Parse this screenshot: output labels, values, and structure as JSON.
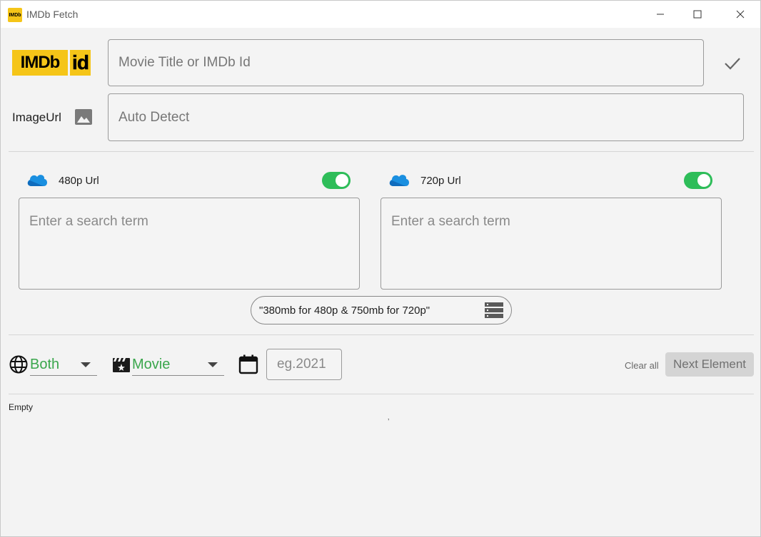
{
  "window": {
    "title": "IMDb Fetch",
    "app_icon_text": "IMDb"
  },
  "header": {
    "logo_imdb": "IMDb",
    "logo_id": "id",
    "title_input_placeholder": "Movie Title or IMDb Id",
    "image_url_label": "ImageUrl",
    "image_url_placeholder": "Auto Detect"
  },
  "urls": [
    {
      "label": "480p Url",
      "enabled": true,
      "placeholder": "Enter a search term"
    },
    {
      "label": "720p Url",
      "enabled": true,
      "placeholder": "Enter a search term"
    }
  ],
  "size_hint": "\"380mb for 480p & 750mb for 720p\"",
  "filters": {
    "language": "Both",
    "type": "Movie",
    "year_placeholder": "eg.2021",
    "clear_label": "Clear all",
    "next_label": "Next Element"
  },
  "status": {
    "empty_text": "Empty",
    "tick": "‚"
  },
  "colors": {
    "accent_green": "#3aa64c",
    "toggle_on": "#2ebd59",
    "imdb_yellow": "#f5c518"
  }
}
